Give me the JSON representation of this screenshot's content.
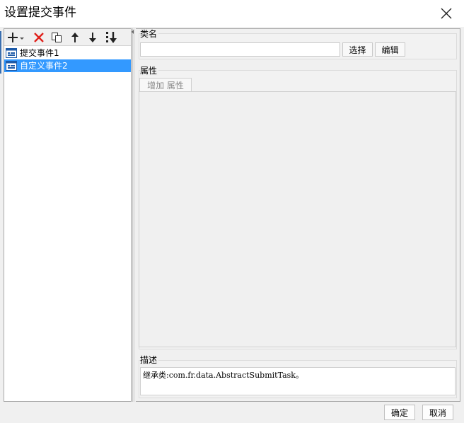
{
  "window": {
    "title": "设置提交事件",
    "close_icon": "close-icon"
  },
  "toolbar": {
    "add_icon": "plus-dropdown-icon",
    "delete_icon": "red-x-delete-icon",
    "copy_icon": "copy-icon",
    "up_icon": "arrow-up-icon",
    "down_icon": "arrow-down-icon",
    "sort_icon": "move-to-bottom-icon"
  },
  "event_list": {
    "items": [
      {
        "label": "提交事件1",
        "selected": false
      },
      {
        "label": "自定义事件2",
        "selected": true
      }
    ]
  },
  "class_section": {
    "label": "类名",
    "value": "",
    "select_button": "选择",
    "edit_button": "编辑"
  },
  "attributes_section": {
    "label": "属性",
    "add_button": "增加 属性"
  },
  "description_section": {
    "label": "描述",
    "text": "继承类:com.fr.data.AbstractSubmitTask。"
  },
  "footer": {
    "ok_button": "确定",
    "cancel_button": "取消"
  },
  "colors": {
    "selection": "#3399ff",
    "delete_red": "#e0201a",
    "border": "#a8a8a8"
  }
}
